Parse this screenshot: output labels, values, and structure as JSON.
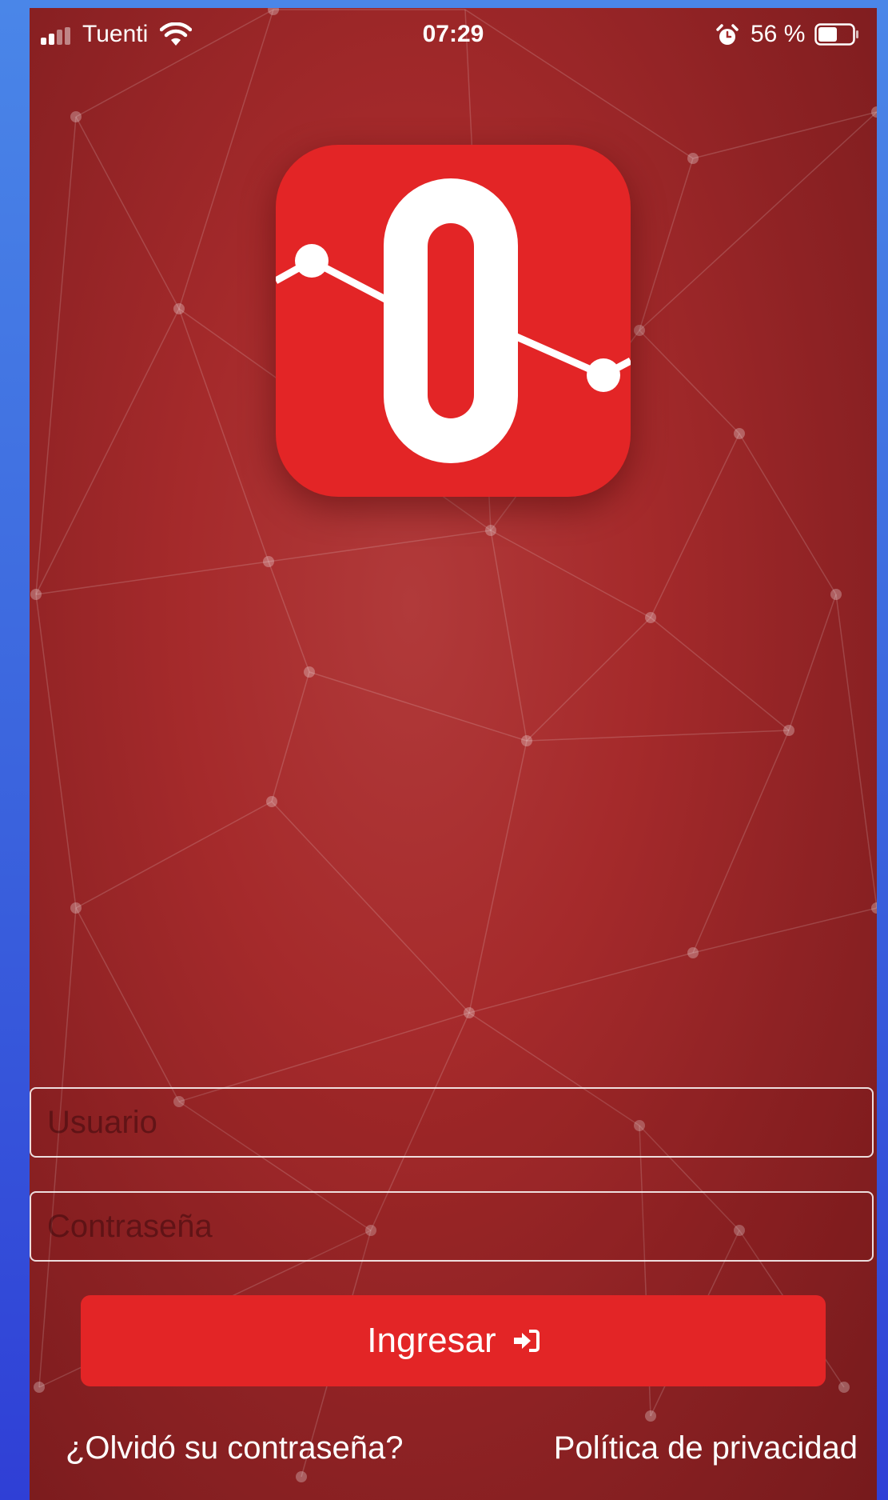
{
  "status_bar": {
    "carrier": "Tuenti",
    "time": "07:29",
    "battery_percent_text": "56 %",
    "battery_level": 0.56,
    "icons": [
      "signal-icon",
      "wifi-icon",
      "alarm-icon",
      "battery-icon"
    ]
  },
  "logo": {
    "icon": "app-logo-icon",
    "brand_color": "#e32526"
  },
  "login": {
    "username_placeholder": "Usuario",
    "username_value": "",
    "password_placeholder": "Contraseña",
    "password_value": "",
    "submit_label": "Ingresar",
    "submit_icon": "sign-in-icon"
  },
  "links": {
    "forgot_password": "¿Olvidó su contraseña?",
    "privacy_policy": "Política de privacidad"
  },
  "colors": {
    "background_top": "#b13a3a",
    "background_bottom": "#761a1c",
    "button": "#e32526",
    "outer_frame": "#3a62dd"
  }
}
